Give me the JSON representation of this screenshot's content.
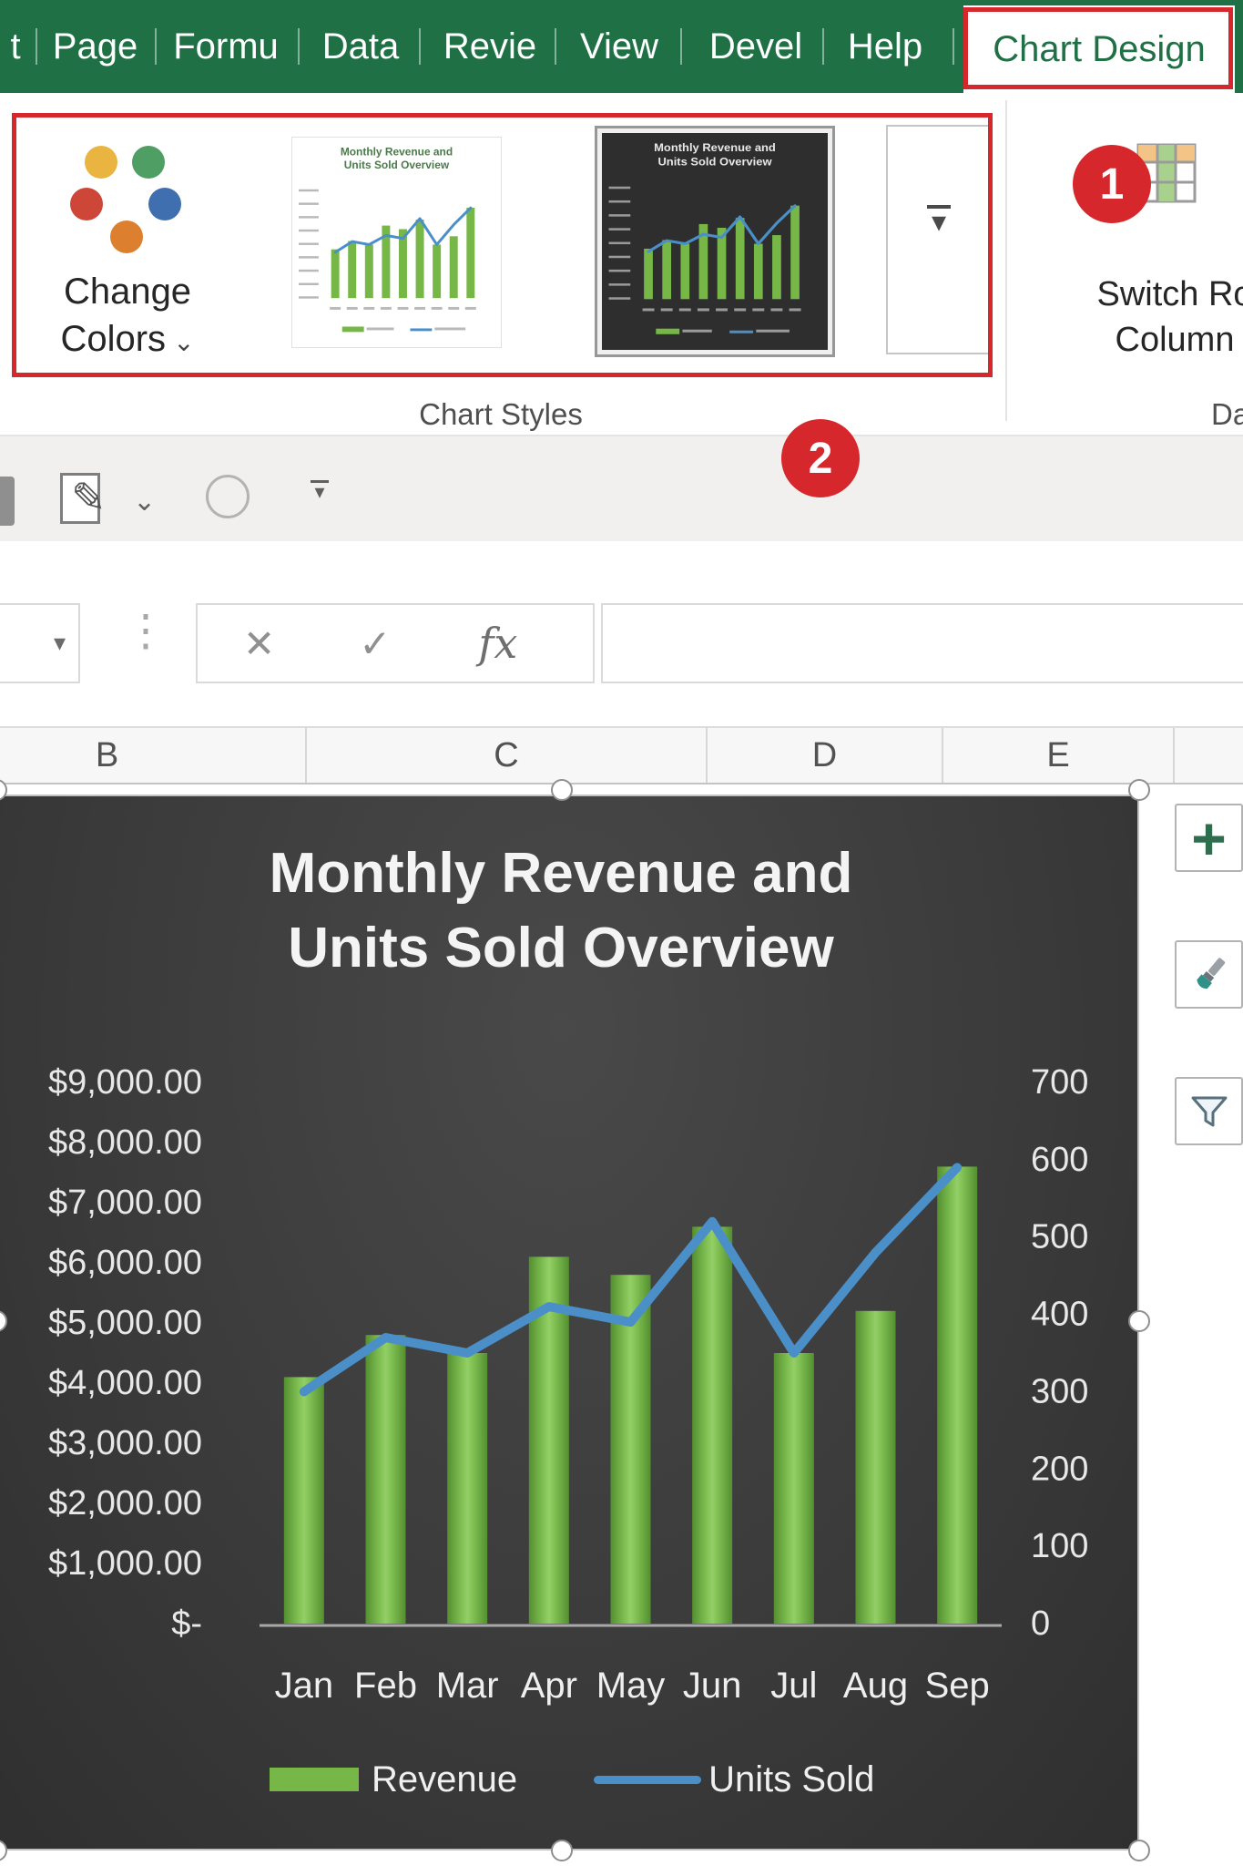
{
  "colors": {
    "ribbon_green": "#1f7145",
    "annotation_red": "#d6282c",
    "bar_green": "#76b747",
    "line_blue": "#4b8fc9",
    "chart_background": "#3b3b3b"
  },
  "ribbon": {
    "tabs": [
      {
        "label": "t",
        "active": false
      },
      {
        "label": "Page",
        "active": false
      },
      {
        "label": "Formu",
        "active": false
      },
      {
        "label": "Data",
        "active": false
      },
      {
        "label": "Revie",
        "active": false
      },
      {
        "label": "View",
        "active": false
      },
      {
        "label": "Devel",
        "active": false
      },
      {
        "label": "Help",
        "active": false
      },
      {
        "label": "Chart Design",
        "active": true
      }
    ],
    "change_colors": {
      "line1": "Change",
      "line2": "Colors"
    },
    "switch_row_column": {
      "line1": "Switch Ro",
      "line2": "Column"
    },
    "group_labels": {
      "chart_styles": "Chart Styles",
      "data": "Da"
    }
  },
  "annotations": {
    "badge1": "1",
    "badge2": "2"
  },
  "icons": {
    "change_colors_chevron": "⌄",
    "gallery_more": "▾",
    "qat_pencil": "✎",
    "qat_chevron": "⌄",
    "customize_arrow": "▾",
    "name_box_chevron": "▾",
    "grip_dots": "⋮",
    "cancel": "✕",
    "enter": "✓",
    "function": "fx",
    "add_element_plus": "+"
  },
  "formula_bar": {
    "value": ""
  },
  "column_headers": [
    "B",
    "C",
    "D",
    "E"
  ],
  "chart_data": {
    "type": "combo-bar-line",
    "title": "Monthly Revenue and Units Sold Overview",
    "categories": [
      "Jan",
      "Feb",
      "Mar",
      "Apr",
      "May",
      "Jun",
      "Jul",
      "Aug",
      "Sep"
    ],
    "series": [
      {
        "name": "Revenue",
        "type": "bar",
        "axis": "left",
        "color": "#76b747",
        "values": [
          4100,
          4800,
          4500,
          6100,
          5800,
          6600,
          4500,
          5200,
          7600
        ]
      },
      {
        "name": "Units Sold",
        "type": "line",
        "axis": "right",
        "color": "#4b8fc9",
        "values": [
          300,
          370,
          350,
          410,
          390,
          520,
          350,
          480,
          590
        ]
      }
    ],
    "left_axis": {
      "min": 0,
      "max": 9000,
      "step": 1000,
      "labels": [
        "$9,000.00",
        "$8,000.00",
        "$7,000.00",
        "$6,000.00",
        "$5,000.00",
        "$4,000.00",
        "$3,000.00",
        "$2,000.00",
        "$1,000.00",
        "$-"
      ]
    },
    "right_axis": {
      "min": 0,
      "max": 700,
      "step": 100,
      "labels": [
        "700",
        "600",
        "500",
        "400",
        "300",
        "200",
        "100",
        "0"
      ]
    },
    "legend": {
      "position": "bottom",
      "entries": [
        "Revenue",
        "Units Sold"
      ]
    },
    "grid": false,
    "style": "dark"
  }
}
